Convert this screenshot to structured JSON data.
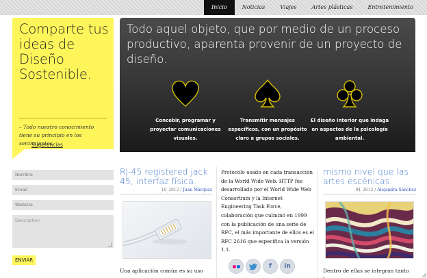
{
  "nav": {
    "items": [
      "Inicio",
      "Noticias",
      "Viajes",
      "Artes plásticas",
      "Entretenimiento"
    ],
    "active": 0
  },
  "intro": {
    "title": "Comparte tus ideas de Diseño Sostenible.",
    "text": "– Todo nuestro conocimiento tiene su principio en los sentimientos.",
    "link": "Sugerencias"
  },
  "hero": {
    "heading": "Todo aquel objeto, que por medio de un proceso productivo, aparenta provenir de un proyecto de diseño.",
    "features": [
      {
        "icon": "heart-icon",
        "text": "Concebir, programar y proyectar comunicaciones visuales."
      },
      {
        "icon": "spade-icon",
        "text": "Transmitir mensajes específicos, con un propósito claro a grupos sociales."
      },
      {
        "icon": "club-icon",
        "text": "El diseño interior que indaga en aspectos de la psicología ambiental."
      }
    ],
    "accent": "#d8c000"
  },
  "form": {
    "name_placeholder": "Nombre",
    "email_placeholder": "Email",
    "website_placeholder": "Website",
    "description_placeholder": "Description",
    "submit_label": "ENVIAR"
  },
  "posts": {
    "a": {
      "title": "RJ-45 registered jack 45, interfaz física.",
      "date": "_10_2012 /",
      "author": "Juan Márquez",
      "excerpt": "Una aplicación común es su uso en"
    },
    "b": {
      "text": "Protocolo usado en cada transacción de la World Wide Web. HTTP fue desarrollado por el World Wide Web Consortium y la Internet Engineering Task Force, colaboración que culminó en 1999 con la publicación de una serie de RFC, el más importante de ellos es el RFC 2616 que especifica la versión 1.1."
    },
    "c": {
      "title": "mismo nivel que las artes escénicas.",
      "date": "_04_2012 /",
      "author": "Alejandra Sánchez",
      "excerpt": "Dentro de ellas se integran tanto la"
    }
  },
  "social": {
    "facebook": "f",
    "linkedin": "in"
  }
}
